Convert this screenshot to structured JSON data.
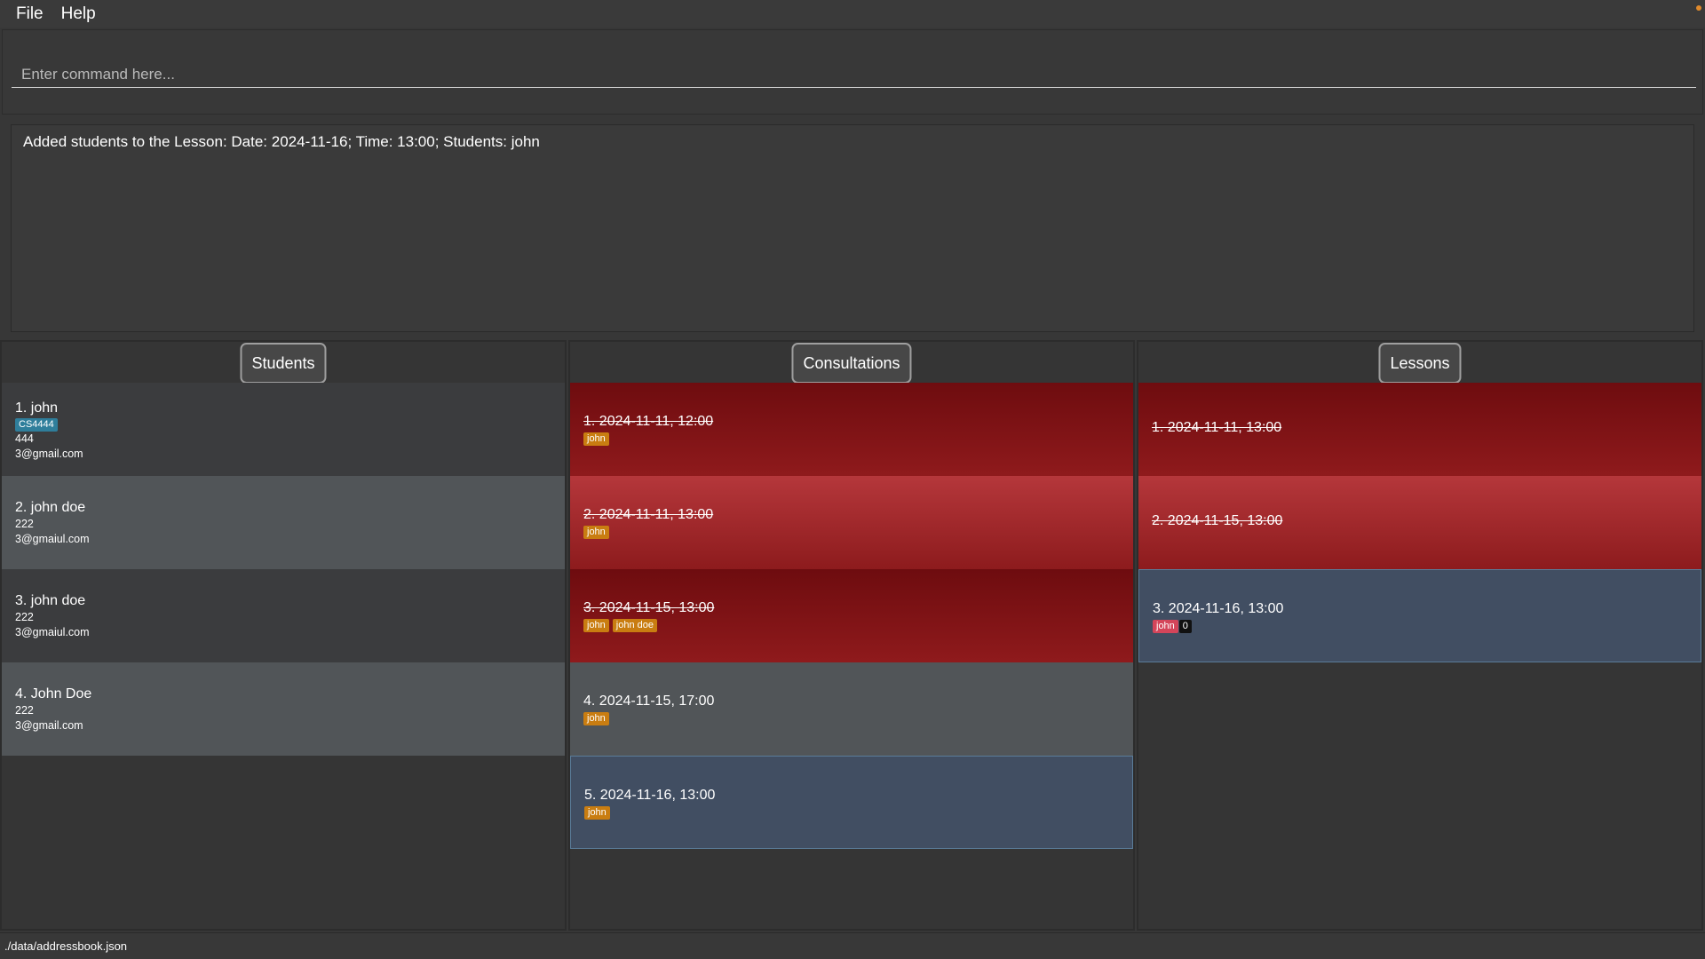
{
  "menu": {
    "file": "File",
    "help": "Help"
  },
  "command": {
    "placeholder": "Enter command here..."
  },
  "result": {
    "text": "Added students to the Lesson: Date: 2024-11-16; Time: 13:00; Students: john"
  },
  "panels": {
    "students": {
      "title": "Students",
      "items": [
        {
          "name": "1. john",
          "tag": "CS4444",
          "phone": "444",
          "email": "3@gmail.com"
        },
        {
          "name": "2. john doe",
          "phone": "222",
          "email": "3@gmaiul.com"
        },
        {
          "name": "3. john  doe",
          "phone": "222",
          "email": "3@gmaiul.com"
        },
        {
          "name": "4. John Doe",
          "phone": "222",
          "email": "3@gmail.com"
        }
      ]
    },
    "consultations": {
      "title": "Consultations",
      "items": [
        {
          "label": "1. 2024-11-11, 12:00",
          "past": true,
          "tags": [
            "john"
          ]
        },
        {
          "label": "2. 2024-11-11, 13:00",
          "past": true,
          "tags": [
            "john"
          ]
        },
        {
          "label": "3. 2024-11-15, 13:00",
          "past": true,
          "tags": [
            "john",
            "john doe"
          ]
        },
        {
          "label": "4. 2024-11-15, 17:00",
          "past": false,
          "tags": [
            "john"
          ]
        },
        {
          "label": "5. 2024-11-16, 13:00",
          "past": false,
          "selected": true,
          "tags": [
            "john"
          ]
        }
      ]
    },
    "lessons": {
      "title": "Lessons",
      "items": [
        {
          "label": "1. 2024-11-11, 13:00",
          "past": true
        },
        {
          "label": "2. 2024-11-15, 13:00",
          "past": true
        },
        {
          "label": "3. 2024-11-16, 13:00",
          "past": false,
          "selected": true,
          "student_tag": "john",
          "count_tag": "0"
        }
      ]
    }
  },
  "status": {
    "path": "./data/addressbook.json"
  },
  "colors": {
    "background": "#373737",
    "past_red": "#8f1a1c",
    "selected_blue": "#414e62",
    "tag_orange": "#c97d11",
    "tag_course": "#2f7e9b",
    "tag_pink": "#d4455a"
  }
}
